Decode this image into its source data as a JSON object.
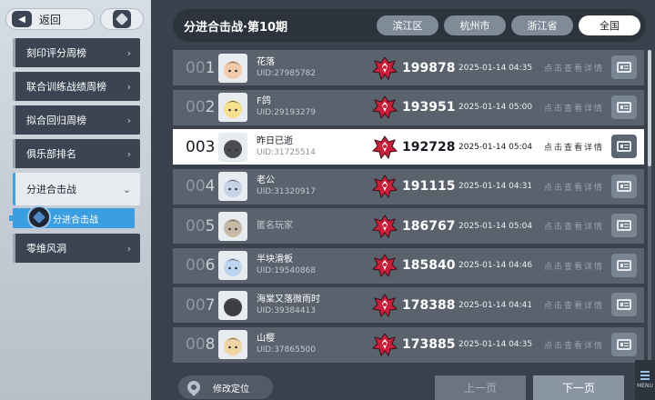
{
  "topbar": {
    "back_label": "返回",
    "help_label": "?"
  },
  "sidebar": {
    "items": [
      {
        "label": "刻印评分周榜"
      },
      {
        "label": "联合训练战绩周榜"
      },
      {
        "label": "拟合回归周榜"
      },
      {
        "label": "俱乐部排名"
      },
      {
        "label": "分进合击战",
        "active": true
      },
      {
        "label": "零维风洞"
      }
    ],
    "sub_item": {
      "label": "分进合击战"
    }
  },
  "header": {
    "title": "分进合击战·第10期",
    "tabs": [
      {
        "label": "滨江区"
      },
      {
        "label": "杭州市"
      },
      {
        "label": "浙江省"
      },
      {
        "label": "全国",
        "active": true
      }
    ]
  },
  "leaderboard": {
    "detail_label": "点击查看详情",
    "rows": [
      {
        "rank_prefix": "00",
        "rank_digit": "1",
        "name": "花落",
        "uid": "UID:27985782",
        "score": "199878",
        "time": "2025-01-14 04:35",
        "avatar_color": "#f4c9a8"
      },
      {
        "rank_prefix": "00",
        "rank_digit": "2",
        "name": "F鸽",
        "uid": "UID:29193279",
        "score": "193951",
        "time": "2025-01-14 05:00",
        "avatar_color": "#f7e08f"
      },
      {
        "rank_prefix": "00",
        "rank_digit": "3",
        "name": "昨日已逝",
        "uid": "UID:31725514",
        "score": "192728",
        "time": "2025-01-14 05:04",
        "highlight": true,
        "avatar_color": "#4a4a52"
      },
      {
        "rank_prefix": "00",
        "rank_digit": "4",
        "name": "老公",
        "uid": "UID:31320917",
        "score": "191115",
        "time": "2025-01-14 04:31",
        "avatar_color": "#c7d3e6"
      },
      {
        "rank_prefix": "00",
        "rank_digit": "5",
        "name": "匿名玩家",
        "uid": "",
        "score": "186767",
        "time": "2025-01-14 05:04",
        "anonymous": true,
        "avatar_color": "#c9b8a6"
      },
      {
        "rank_prefix": "00",
        "rank_digit": "6",
        "name": "半块滑板",
        "uid": "UID:19540868",
        "score": "185840",
        "time": "2025-01-14 04:46",
        "avatar_color": "#bcd6f0"
      },
      {
        "rank_prefix": "00",
        "rank_digit": "7",
        "name": "海棠又落微雨时",
        "uid": "UID:39384413",
        "score": "178388",
        "time": "2025-01-14 04:41",
        "avatar_color": "#3f3c44"
      },
      {
        "rank_prefix": "00",
        "rank_digit": "8",
        "name": "山樱",
        "uid": "UID:37865500",
        "score": "173885",
        "time": "2025-01-14 04:35",
        "avatar_color": "#f1d6a4"
      }
    ]
  },
  "footer": {
    "location_label": "修改定位",
    "prev_label": "上一页",
    "next_label": "下一页",
    "menu_label": "MENU"
  }
}
